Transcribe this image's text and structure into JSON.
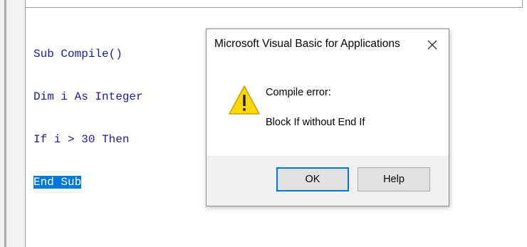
{
  "editor": {
    "code_lines": [
      "Sub Compile()",
      "Dim i As Integer",
      "If i > 30 Then",
      "End Sub"
    ],
    "selected_line_index": 3
  },
  "dialog": {
    "title": "Microsoft Visual Basic for Applications",
    "close_icon": "close-icon",
    "icon": "warning-icon",
    "message_title": "Compile error:",
    "message_body": "Block If without End If",
    "ok_label": "OK",
    "help_label": "Help"
  },
  "colors": {
    "code_text": "#1a1aa0",
    "selection": "#0078d7",
    "warning_fill": "#ffd800",
    "focus_border": "#0078d7"
  }
}
